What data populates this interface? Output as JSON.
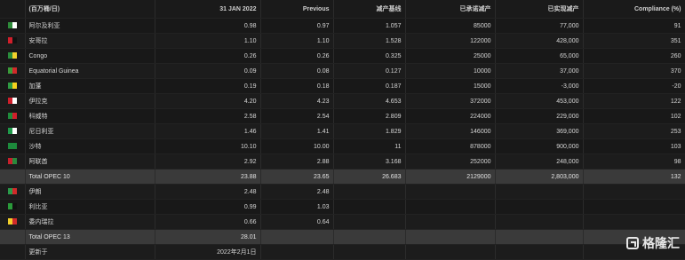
{
  "header": {
    "unit": "(百万桶/日)",
    "date_col": "31 JAN 2022",
    "previous": "Previous",
    "baseline": "减产基线",
    "committed": "已承诺减产",
    "achieved": "已实现减产",
    "compliance": "Compliance (%)"
  },
  "rows": [
    {
      "name": "阿尔及利亚",
      "value": "0.98",
      "prev": "0.97",
      "baseline": "1.057",
      "committed": "85000",
      "achieved": "77,000",
      "compliance": "91",
      "flag": [
        "#2e8b3a",
        "#ffffff"
      ]
    },
    {
      "name": "安哥拉",
      "value": "1.10",
      "prev": "1.10",
      "baseline": "1.528",
      "committed": "122000",
      "achieved": "428,000",
      "compliance": "351",
      "flag": [
        "#d01f2b",
        "#111111"
      ]
    },
    {
      "name": "Congo",
      "value": "0.26",
      "prev": "0.26",
      "baseline": "0.325",
      "committed": "25000",
      "achieved": "65,000",
      "compliance": "260",
      "flag": [
        "#2a8c3c",
        "#f2d22c"
      ]
    },
    {
      "name": "Equatorial Guinea",
      "value": "0.09",
      "prev": "0.08",
      "baseline": "0.127",
      "committed": "10000",
      "achieved": "37,000",
      "compliance": "370",
      "flag": [
        "#3a9a3a",
        "#d12a2a"
      ]
    },
    {
      "name": "加蓬",
      "value": "0.19",
      "prev": "0.18",
      "baseline": "0.187",
      "committed": "15000",
      "achieved": "-3,000",
      "compliance": "-20",
      "flag": [
        "#2f9a43",
        "#f5d11e"
      ]
    },
    {
      "name": "伊拉克",
      "value": "4.20",
      "prev": "4.23",
      "baseline": "4.653",
      "committed": "372000",
      "achieved": "453,000",
      "compliance": "122",
      "flag": [
        "#d01f2b",
        "#ffffff"
      ]
    },
    {
      "name": "科威特",
      "value": "2.58",
      "prev": "2.54",
      "baseline": "2.809",
      "committed": "224000",
      "achieved": "229,000",
      "compliance": "102",
      "flag": [
        "#1f8a3b",
        "#d01f2b"
      ]
    },
    {
      "name": "尼日利亚",
      "value": "1.46",
      "prev": "1.41",
      "baseline": "1.829",
      "committed": "146000",
      "achieved": "369,000",
      "compliance": "253",
      "flag": [
        "#1f9a4a",
        "#ffffff"
      ]
    },
    {
      "name": "沙特",
      "value": "10.10",
      "prev": "10.00",
      "baseline": "11",
      "committed": "878000",
      "achieved": "900,000",
      "compliance": "103",
      "flag": [
        "#1d8a3c",
        "#1d8a3c"
      ]
    },
    {
      "name": "阿联酋",
      "value": "2.92",
      "prev": "2.88",
      "baseline": "3.168",
      "committed": "252000",
      "achieved": "248,000",
      "compliance": "98",
      "flag": [
        "#c8202c",
        "#2a8a3c"
      ]
    }
  ],
  "total10": {
    "name": "Total OPEC 10",
    "value": "23.88",
    "prev": "23.65",
    "baseline": "26.683",
    "committed": "2129000",
    "achieved": "2,803,000",
    "compliance": "132"
  },
  "rows2": [
    {
      "name": "伊朗",
      "value": "2.48",
      "prev": "2.48",
      "flag": [
        "#2a9a4a",
        "#d12a2a"
      ]
    },
    {
      "name": "利比亚",
      "value": "0.99",
      "prev": "1.03",
      "flag": [
        "#2a9a3a",
        "#111111"
      ]
    },
    {
      "name": "委内瑞拉",
      "value": "0.66",
      "prev": "0.64",
      "flag": [
        "#f2cf2a",
        "#d12a2a"
      ]
    }
  ],
  "total13": {
    "name": "Total OPEC 13",
    "value": "28.01"
  },
  "footer": {
    "label": "更新于",
    "date": "2022年2月1日"
  },
  "watermark": "格隆汇"
}
